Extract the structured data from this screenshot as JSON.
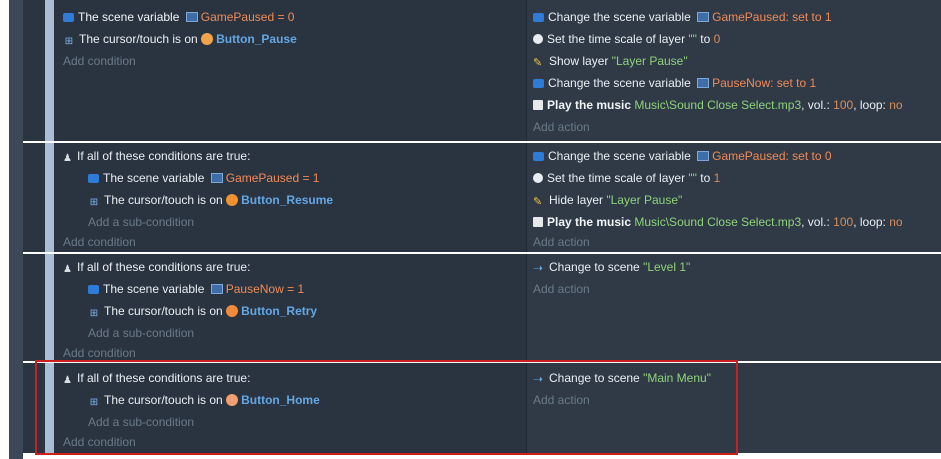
{
  "events": [
    {
      "conditions": [
        {
          "icon": "variable-icon",
          "text": "The scene variable",
          "var": "GamePaused",
          "tail": " = 0"
        },
        {
          "icon": "cursor-icon",
          "text": "The cursor/touch is on",
          "object": "Button_Pause"
        },
        {
          "muted": "Add condition"
        }
      ],
      "actions": [
        {
          "icon": "variable-icon",
          "text": "Change the scene variable",
          "var": "GamePaused",
          "tail": ": set to 1"
        },
        {
          "icon": "time-icon",
          "text": "Set the time scale of layer",
          "str": "\"\"",
          "tail2": "to",
          "num": "0"
        },
        {
          "icon": "layer-icon",
          "text": "Show layer",
          "str": "\"Layer Pause\""
        },
        {
          "icon": "variable-icon",
          "text": "Change the scene variable",
          "var": "PauseNow",
          "tail": ": set to 1"
        },
        {
          "icon": "music-icon",
          "text": "Play the music",
          "file": "Music\\Sound Close Select.mp3",
          "vol_label": ", vol.:",
          "vol": "100",
          "loop_label": ", loop:",
          "loop": "no"
        },
        {
          "muted": "Add action"
        }
      ]
    },
    {
      "conditions": [
        {
          "icon": "group-icon",
          "text": "If all of these conditions are true:"
        },
        {
          "icon": "variable-icon",
          "text": "The scene variable",
          "var": "GamePaused",
          "tail": " = 1"
        },
        {
          "icon": "cursor-icon",
          "text": "The cursor/touch is on",
          "object": "Button_Resume"
        },
        {
          "muted": "Add a sub-condition"
        },
        {
          "muted": "Add condition"
        }
      ],
      "actions": [
        {
          "icon": "variable-icon",
          "text": "Change the scene variable",
          "var": "GamePaused",
          "tail": ": set to 0"
        },
        {
          "icon": "time-icon",
          "text": "Set the time scale of layer",
          "str": "\"\"",
          "tail2": "to",
          "num": "1"
        },
        {
          "icon": "layer-icon",
          "text": "Hide layer",
          "str": "\"Layer Pause\""
        },
        {
          "icon": "music-icon",
          "text": "Play the music",
          "file": "Music\\Sound Close Select.mp3",
          "vol_label": ", vol.:",
          "vol": "100",
          "loop_label": ", loop:",
          "loop": "no"
        },
        {
          "muted": "Add action"
        }
      ]
    },
    {
      "conditions": [
        {
          "icon": "group-icon",
          "text": "If all of these conditions are true:"
        },
        {
          "icon": "variable-icon",
          "text": "The scene variable",
          "var": "PauseNow",
          "tail": " = 1"
        },
        {
          "icon": "cursor-icon",
          "text": "The cursor/touch is on",
          "object": "Button_Retry"
        },
        {
          "muted": "Add a sub-condition"
        },
        {
          "muted": "Add condition"
        }
      ],
      "actions": [
        {
          "icon": "scene-icon",
          "text": "Change to scene",
          "str": "\"Level 1\""
        },
        {
          "muted": "Add action"
        }
      ]
    },
    {
      "conditions": [
        {
          "icon": "group-icon",
          "text": "If all of these conditions are true:"
        },
        {
          "icon": "cursor-icon",
          "text": "The cursor/touch is on",
          "object": "Button_Home"
        },
        {
          "muted": "Add a sub-condition"
        },
        {
          "muted": "Add condition"
        }
      ],
      "actions": [
        {
          "icon": "scene-icon",
          "text": "Change to scene",
          "str": "\"Main Menu\""
        },
        {
          "muted": "Add action"
        }
      ]
    }
  ],
  "colors": {
    "highlight": "#cc1f1f",
    "variable_name": "#f28a55",
    "object_name": "#63a7e4",
    "string_value": "#8fd27a",
    "muted": "#6b7a88"
  }
}
